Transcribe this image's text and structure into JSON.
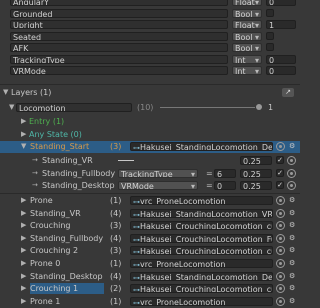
{
  "params": [
    {
      "name": "AngularY",
      "type": "Float",
      "value": "0"
    },
    {
      "name": "Grounded",
      "type": "Bool",
      "value": ""
    },
    {
      "name": "Upright",
      "type": "Float",
      "value": "1"
    },
    {
      "name": "Seated",
      "type": "Bool",
      "value": ""
    },
    {
      "name": "AFK",
      "type": "Bool",
      "value": ""
    },
    {
      "name": "TrackingType",
      "type": "Int",
      "value": "0"
    },
    {
      "name": "VRMode",
      "type": "Int",
      "value": "0"
    }
  ],
  "layers_header": "Layers (1)",
  "layer": {
    "name": "Locomotion",
    "count": "(10)",
    "slider_value": "1"
  },
  "entry": "Entry (1)",
  "any_state": "Any State (0)",
  "standing_start": {
    "name": "Standing_Start",
    "count": "(3)",
    "motion": "Hakusei_StandingLocomotion_Deskto"
  },
  "children": [
    {
      "name": "Standing_VR",
      "param": "",
      "mode": "",
      "threshold": "",
      "value": "0.25"
    },
    {
      "name": "Standing_Fullbody",
      "param": "TrackingType",
      "mode": "=",
      "threshold": "6",
      "value": "0.25"
    },
    {
      "name": "Standing_Desktop",
      "param": "VRMode",
      "mode": "=",
      "threshold": "0",
      "value": "0.25"
    }
  ],
  "states": [
    {
      "name": "Prone",
      "count": "(1)",
      "motion": "vrc_ProneLocomotion",
      "highlight": false
    },
    {
      "name": "Standing_VR",
      "count": "(4)",
      "motion": "Hakusei_StandingLocomotion_VR",
      "highlight": false
    },
    {
      "name": "Crouching",
      "count": "(3)",
      "motion": "Hakusei_CrouchingLocomotion_cute",
      "highlight": false
    },
    {
      "name": "Standing_Fullbody",
      "count": "(4)",
      "motion": "Hakusei_CrouchingLocomotion_FullBo",
      "highlight": false
    },
    {
      "name": "Crouching 2",
      "count": "(3)",
      "motion": "Hakusei_CrouchingLocomotion_cute",
      "highlight": false
    },
    {
      "name": "Prone 0",
      "count": "(1)",
      "motion": "vrc_ProneLocomotion",
      "highlight": false
    },
    {
      "name": "Standing_Desktop",
      "count": "(4)",
      "motion": "Hakusei_StandingLocomotion_Deskto",
      "highlight": false
    },
    {
      "name": "Crouching 1",
      "count": "(2)",
      "motion": "Hakusei_CrouchingLocomotion_cute",
      "highlight": true
    },
    {
      "name": "Prone 1",
      "count": "(1)",
      "motion": "vrc_ProneLocomotion",
      "highlight": false
    }
  ],
  "icons": {
    "collapse": "triangle-down-icon",
    "expand": "triangle-right-icon",
    "settings": "gear-icon",
    "object": "object-picker-icon",
    "motion": "animation-clip-icon"
  }
}
